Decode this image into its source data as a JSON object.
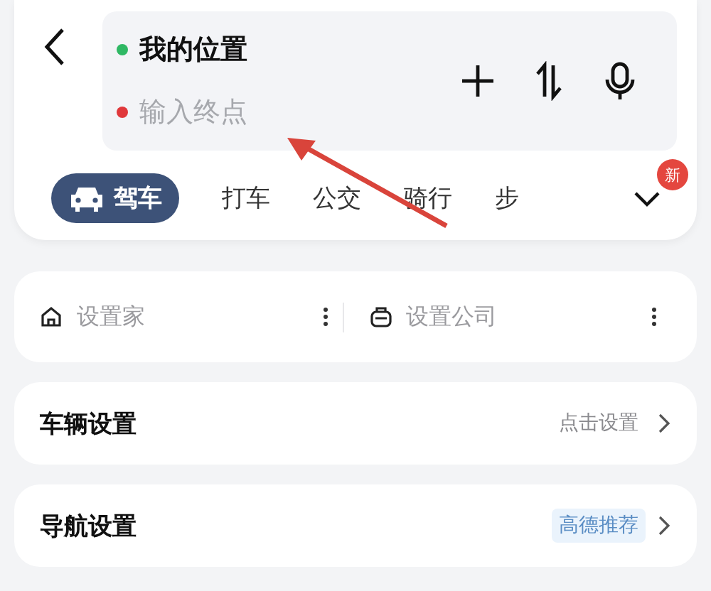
{
  "route": {
    "start": {
      "value": "我的位置",
      "color": "#2fb864"
    },
    "end": {
      "placeholder": "输入终点",
      "color": "#e0383b"
    }
  },
  "modes": [
    {
      "label": "驾车",
      "selected": true
    },
    {
      "label": "打车",
      "selected": false
    },
    {
      "label": "公交",
      "selected": false
    },
    {
      "label": "骑行",
      "selected": false
    },
    {
      "label": "步",
      "selected": false
    }
  ],
  "more_badge": "新",
  "shortcuts": [
    {
      "kind": "home",
      "label": "设置家"
    },
    {
      "kind": "work",
      "label": "设置公司"
    }
  ],
  "settings": [
    {
      "title": "车辆设置",
      "value": "点击设置",
      "highlighted": false
    },
    {
      "title": "导航设置",
      "value": "高德推荐",
      "highlighted": true
    }
  ]
}
